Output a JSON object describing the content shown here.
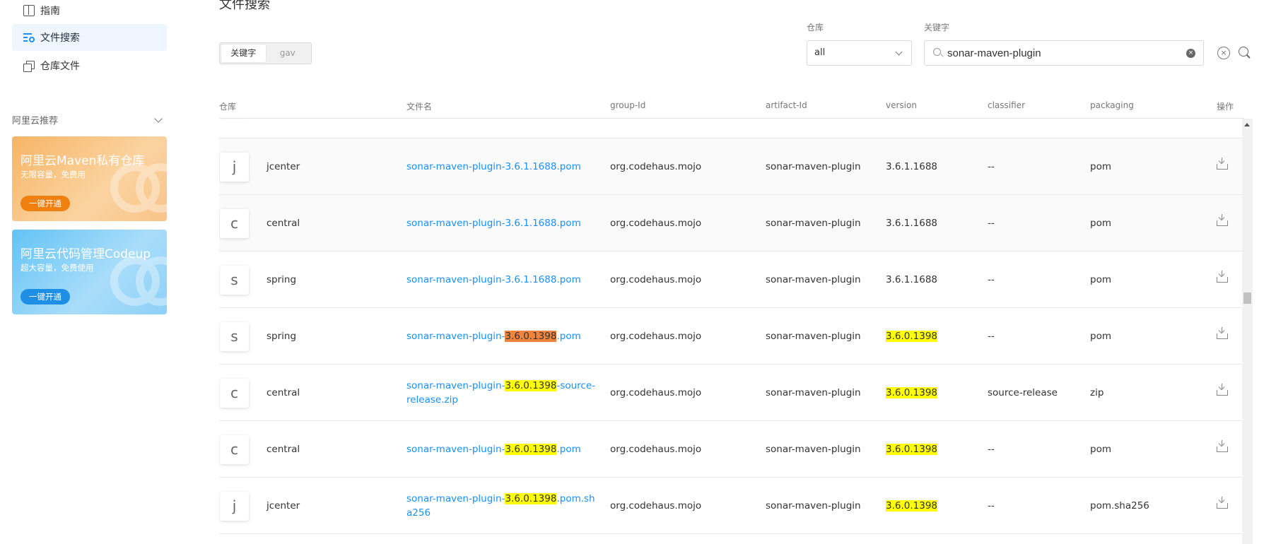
{
  "sidebar": {
    "nav": [
      {
        "label": "指南",
        "icon": "book-icon"
      },
      {
        "label": "文件搜索",
        "icon": "file-search-icon",
        "active": true
      },
      {
        "label": "仓库文件",
        "icon": "copy-icon"
      }
    ],
    "section_title": "阿里云推荐",
    "promos": [
      {
        "title": "阿里云Maven私有仓库",
        "subtitle": "无限容量，免费用",
        "button": "一键开通",
        "color": "#f6b565"
      },
      {
        "title": "阿里云代码管理Codeup",
        "subtitle": "超大容量，免费使用",
        "button": "一键开通",
        "color": "#63c3f4"
      }
    ]
  },
  "main": {
    "title": "文件搜索",
    "mode_tabs": [
      {
        "label": "关键字",
        "selected": true
      },
      {
        "label": "gav",
        "selected": false
      }
    ],
    "repo_label": "仓库",
    "repo_value": "all",
    "keyword_label": "关键字",
    "keyword_value": "sonar-maven-plugin"
  },
  "table": {
    "headers": [
      "仓库",
      "文件名",
      "group-Id",
      "artifact-Id",
      "version",
      "classifier",
      "packaging",
      "操作"
    ],
    "partial_row_tail": "56",
    "rows": [
      {
        "avatar": "j",
        "repo": "jcenter",
        "fname_pre": "sonar-maven-plugin-3.6.1.1688.pom",
        "fname_hl": "",
        "fname_post": "",
        "hl_color": "yellow",
        "group": "org.codehaus.mojo",
        "artifact": "sonar-maven-plugin",
        "version": "3.6.1.1688",
        "version_hl": false,
        "classifier": "--",
        "packaging": "pom"
      },
      {
        "avatar": "c",
        "repo": "central",
        "fname_pre": "sonar-maven-plugin-3.6.1.1688.pom",
        "fname_hl": "",
        "fname_post": "",
        "hl_color": "yellow",
        "group": "org.codehaus.mojo",
        "artifact": "sonar-maven-plugin",
        "version": "3.6.1.1688",
        "version_hl": false,
        "classifier": "--",
        "packaging": "pom"
      },
      {
        "avatar": "s",
        "repo": "spring",
        "fname_pre": "sonar-maven-plugin-3.6.1.1688.pom",
        "fname_hl": "",
        "fname_post": "",
        "hl_color": "yellow",
        "group": "org.codehaus.mojo",
        "artifact": "sonar-maven-plugin",
        "version": "3.6.1.1688",
        "version_hl": false,
        "classifier": "--",
        "packaging": "pom"
      },
      {
        "avatar": "s",
        "repo": "spring",
        "fname_pre": "sonar-maven-plugin-",
        "fname_hl": "3.6.0.1398",
        "fname_post": ".pom",
        "hl_color": "orange",
        "group": "org.codehaus.mojo",
        "artifact": "sonar-maven-plugin",
        "version": "3.6.0.1398",
        "version_hl": true,
        "classifier": "--",
        "packaging": "pom"
      },
      {
        "avatar": "c",
        "repo": "central",
        "fname_pre": "sonar-maven-plugin-",
        "fname_hl": "3.6.0.1398",
        "fname_post": "-source-release.zip",
        "hl_color": "yellow",
        "group": "org.codehaus.mojo",
        "artifact": "sonar-maven-plugin",
        "version": "3.6.0.1398",
        "version_hl": true,
        "classifier": "source-release",
        "packaging": "zip"
      },
      {
        "avatar": "c",
        "repo": "central",
        "fname_pre": "sonar-maven-plugin-",
        "fname_hl": "3.6.0.1398",
        "fname_post": ".pom",
        "hl_color": "yellow",
        "group": "org.codehaus.mojo",
        "artifact": "sonar-maven-plugin",
        "version": "3.6.0.1398",
        "version_hl": true,
        "classifier": "--",
        "packaging": "pom"
      },
      {
        "avatar": "j",
        "repo": "jcenter",
        "fname_pre": "sonar-maven-plugin-",
        "fname_hl": "3.6.0.1398",
        "fname_post": ".pom.sha256",
        "hl_color": "yellow",
        "group": "org.codehaus.mojo",
        "artifact": "sonar-maven-plugin",
        "version": "3.6.0.1398",
        "version_hl": true,
        "classifier": "--",
        "packaging": "pom.sha256"
      }
    ]
  },
  "colors": {
    "link": "#1890ff",
    "highlight": "#ffff00",
    "highlight_active": "#f0843c"
  }
}
